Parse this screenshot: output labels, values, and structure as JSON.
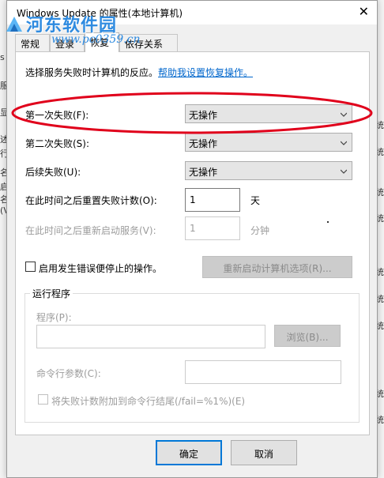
{
  "window": {
    "title": "Windows Update 的属性(本地计算机)",
    "close_symbol": "✕"
  },
  "watermark": {
    "text": "河东软件园",
    "url": "www.pc0359.cn"
  },
  "tabs": [
    {
      "label": "常规",
      "active": false
    },
    {
      "label": "登录",
      "active": false
    },
    {
      "label": "恢复",
      "active": true
    },
    {
      "label": "依存关系",
      "active": false
    }
  ],
  "recovery": {
    "intro": "选择服务失败时计算机的反应。",
    "help_link": "帮助我设置恢复操作。",
    "first_failure": {
      "label": "第一次失败(F):",
      "value": "无操作"
    },
    "second_failure": {
      "label": "第二次失败(S):",
      "value": "无操作"
    },
    "subsequent_failures": {
      "label": "后续失败(U):",
      "value": "无操作"
    },
    "reset_count": {
      "label": "在此时间之后重置失败计数(O):",
      "value": "1",
      "unit": "天"
    },
    "restart_service": {
      "label": "在此时间之后重新启动服务(V):",
      "value": "1",
      "unit": "分钟"
    },
    "enable_actions_checkbox": {
      "label": "启用发生错误便停止的操作。",
      "checked": false
    },
    "restart_options_button": "重新启动计算机选项(R)...",
    "run_program": {
      "group_title": "运行程序",
      "program_label": "程序(P):",
      "program_value": "",
      "browse_button": "浏览(B)...",
      "params_label": "命令行参数(C):",
      "params_value": "",
      "append_checkbox": {
        "label": "将失败计数附加到命令行结尾(/fail=%1%)(E)",
        "checked": false
      }
    }
  },
  "buttons": {
    "ok": "确定",
    "cancel": "取消"
  },
  "background": {
    "left_fragments": [
      "s",
      "服",
      "显",
      "述",
      "行",
      "名",
      "启",
      "名",
      "(V"
    ],
    "right_fragments": [
      "统",
      "统",
      "统",
      "统",
      "统",
      "统",
      "统",
      "统",
      "统"
    ]
  },
  "colors": {
    "accent": "#0078d7",
    "link": "#0066cc",
    "annotation": "#e0001b",
    "watermark": "#2f8be0"
  }
}
